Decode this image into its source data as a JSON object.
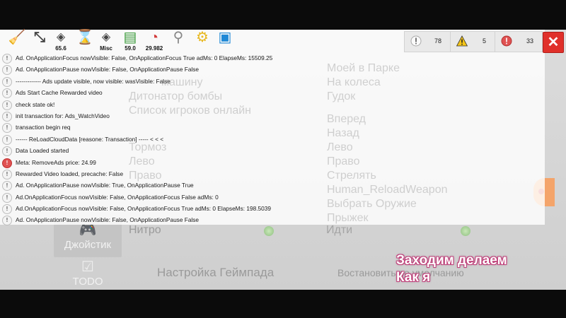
{
  "game_menu": {
    "left_labels": [
      "машину",
      "Дитонатор бомбы",
      "Список игроков онлайн",
      "Тормоз",
      "Лево",
      "Право",
      "Нитро"
    ],
    "right_labels": [
      "Моей в Парке",
      "На колеса",
      "Гудок",
      "Вперед",
      "Назад",
      "Лево",
      "Право",
      "Стрелять",
      "Human_ReloadWeapon",
      "Выбрать Оружие",
      "Прыжек",
      "Идти"
    ],
    "sidebar_joystick": "Джойстик",
    "sidebar_todo": "TODO",
    "gamepad_settings": "Настройка Геймпада",
    "restore_defaults": "Востановить по умолчанию"
  },
  "toolbar": {
    "fps": "65.6",
    "misc": "Misc",
    "memory": "59.0",
    "time": "29.982"
  },
  "counters": {
    "log_count": "78",
    "warning_count": "5",
    "error_count": "33"
  },
  "log": [
    {
      "level": "info",
      "text": "Ad. OnApplicationFocus nowVisible: False, OnApplicationFocus True adMs: 0 ElapseMs: 15509.25"
    },
    {
      "level": "info",
      "text": "Ad. OnApplicationPause nowVisible: False, OnApplicationPause False"
    },
    {
      "level": "info",
      "text": "------------- Ads update visible, now visible:   wasVisible: False"
    },
    {
      "level": "info",
      "text": "Ads Start Cache Rewarded video"
    },
    {
      "level": "info",
      "text": "check state ok!"
    },
    {
      "level": "info",
      "text": "init transaction for: Ads_WatchVideo"
    },
    {
      "level": "info",
      "text": "transaction begin req"
    },
    {
      "level": "info",
      "text": "------ ReLoadCloudData [reasone: Transaction] ----- < < <"
    },
    {
      "level": "info",
      "text": "Data Loaded started"
    },
    {
      "level": "error",
      "text": "Meta: RemoveAds price: 24.99"
    },
    {
      "level": "info",
      "text": "Rewarded Video loaded, precache: False"
    },
    {
      "level": "info",
      "text": "Ad. OnApplicationPause nowVisible: True, OnApplicationPause True"
    },
    {
      "level": "info",
      "text": "Ad.OnApplicationFocus nowVisible: False, OnApplicationFocus False adMs: 0"
    },
    {
      "level": "info",
      "text": "Ad.OnApplicationFocus nowVisible: False, OnApplicationFocus True adMs: 0 ElapseMs: 198.5039"
    },
    {
      "level": "info",
      "text": "Ad. OnApplicationPause nowVisible: False, OnApplicationPause False"
    }
  ],
  "caption": {
    "line1": "Заходим делаем",
    "line2": "Как я"
  },
  "colors": {
    "close_red": "#e0302a",
    "error_red": "#e05252",
    "warning_yellow": "#f5c518",
    "caption_outline": "#c0407a"
  }
}
